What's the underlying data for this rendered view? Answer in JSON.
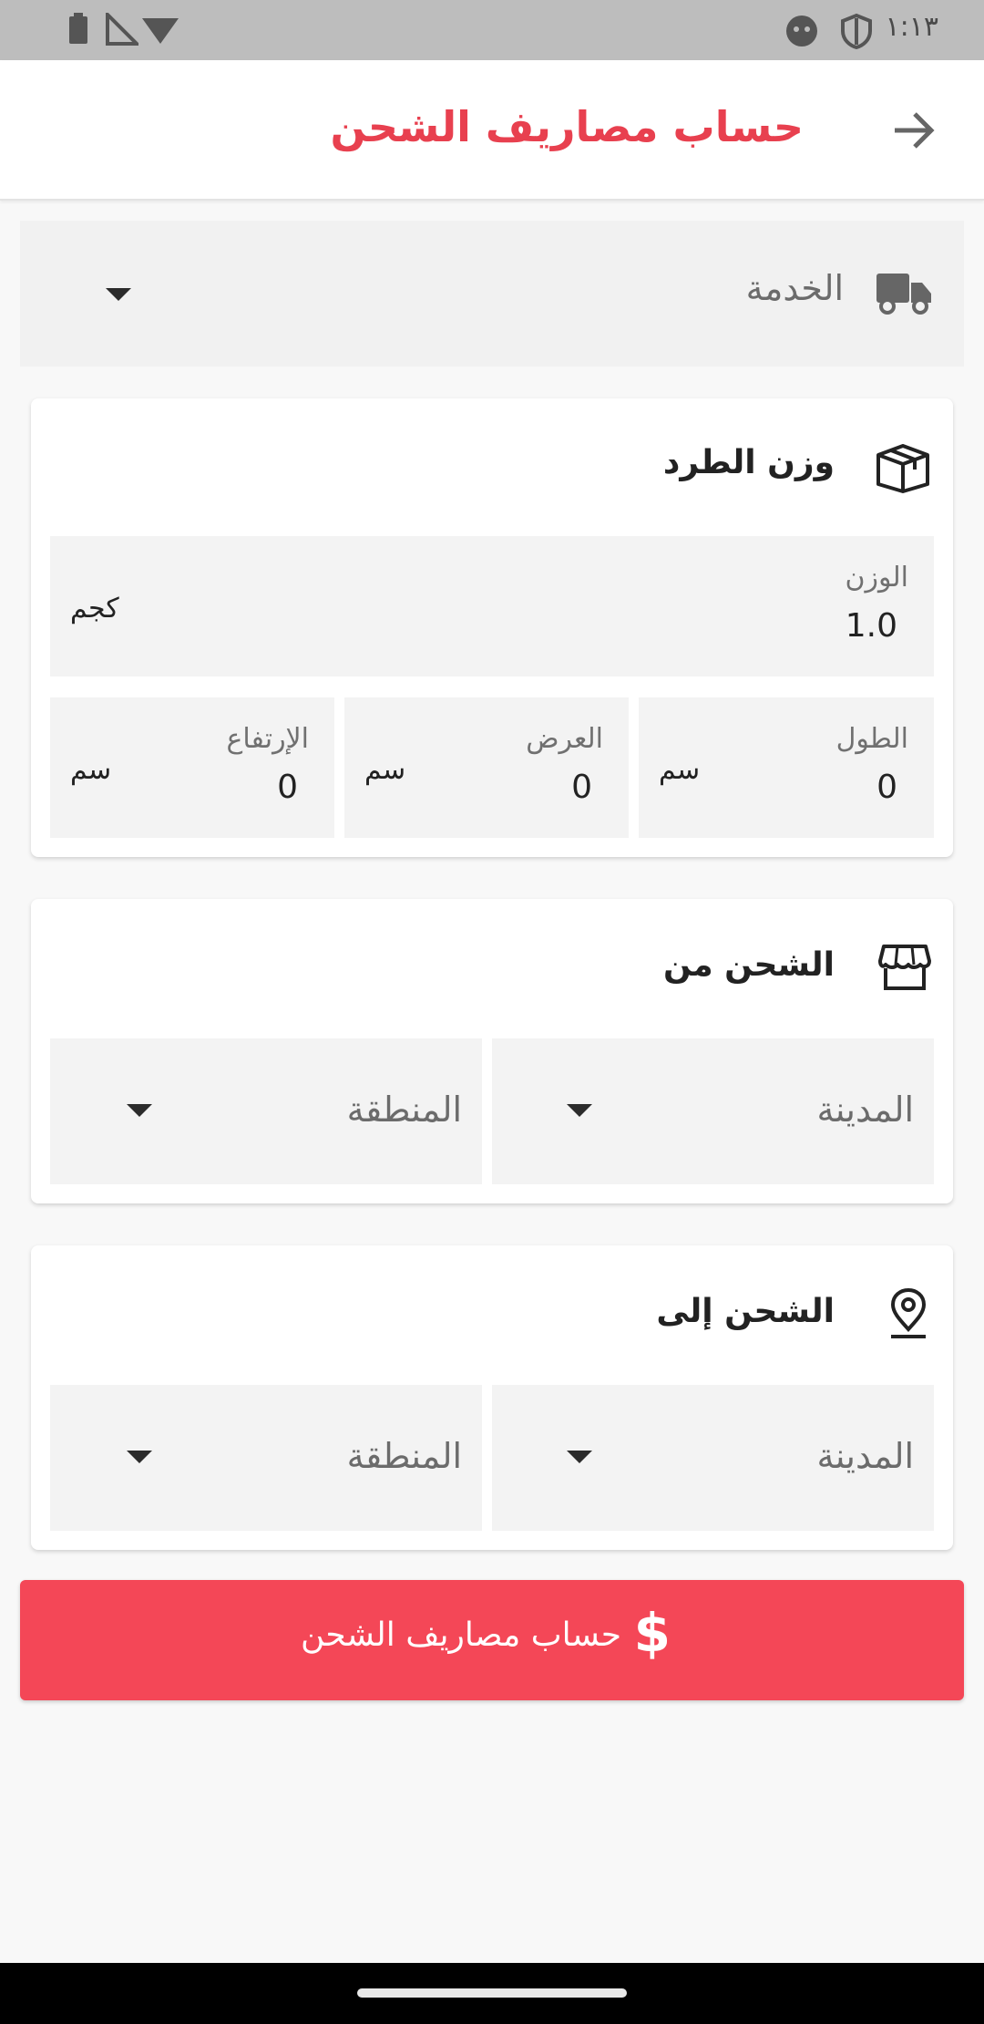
{
  "status_bar": {
    "time": "١:١٣"
  },
  "app_bar": {
    "title": "حساب مصاريف الشحن",
    "back_icon": "arrow-right-icon"
  },
  "service": {
    "label": "الخدمة",
    "icon": "truck-icon"
  },
  "package": {
    "title": "وزن الطرد",
    "icon": "box-icon",
    "weight": {
      "label": "الوزن",
      "value": "1.0",
      "unit": "كجم"
    },
    "length": {
      "label": "الطول",
      "value": "0",
      "unit": "سم"
    },
    "width": {
      "label": "العرض",
      "value": "0",
      "unit": "سم"
    },
    "height": {
      "label": "الإرتفاع",
      "value": "0",
      "unit": "سم"
    }
  },
  "ship_from": {
    "title": "الشحن من",
    "icon": "store-icon",
    "city": "المدينة",
    "area": "المنطقة"
  },
  "ship_to": {
    "title": "الشحن إلى",
    "icon": "location-pin-icon",
    "city": "المدينة",
    "area": "المنطقة"
  },
  "calculate_button": {
    "label": "حساب مصاريف الشحن",
    "icon": "$"
  },
  "colors": {
    "accent": "#e8404f",
    "button": "#f44757"
  }
}
